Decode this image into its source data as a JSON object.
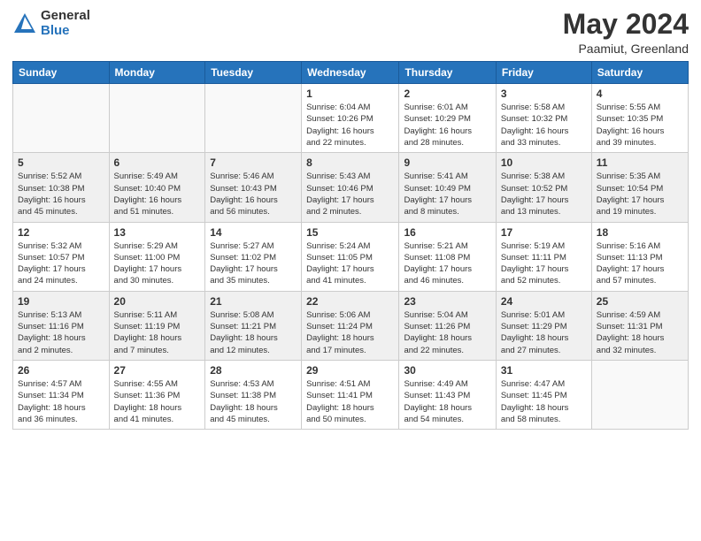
{
  "header": {
    "logo_general": "General",
    "logo_blue": "Blue",
    "month_title": "May 2024",
    "location": "Paamiut, Greenland"
  },
  "weekdays": [
    "Sunday",
    "Monday",
    "Tuesday",
    "Wednesday",
    "Thursday",
    "Friday",
    "Saturday"
  ],
  "weeks": [
    [
      {
        "day": "",
        "info": ""
      },
      {
        "day": "",
        "info": ""
      },
      {
        "day": "",
        "info": ""
      },
      {
        "day": "1",
        "info": "Sunrise: 6:04 AM\nSunset: 10:26 PM\nDaylight: 16 hours\nand 22 minutes."
      },
      {
        "day": "2",
        "info": "Sunrise: 6:01 AM\nSunset: 10:29 PM\nDaylight: 16 hours\nand 28 minutes."
      },
      {
        "day": "3",
        "info": "Sunrise: 5:58 AM\nSunset: 10:32 PM\nDaylight: 16 hours\nand 33 minutes."
      },
      {
        "day": "4",
        "info": "Sunrise: 5:55 AM\nSunset: 10:35 PM\nDaylight: 16 hours\nand 39 minutes."
      }
    ],
    [
      {
        "day": "5",
        "info": "Sunrise: 5:52 AM\nSunset: 10:38 PM\nDaylight: 16 hours\nand 45 minutes."
      },
      {
        "day": "6",
        "info": "Sunrise: 5:49 AM\nSunset: 10:40 PM\nDaylight: 16 hours\nand 51 minutes."
      },
      {
        "day": "7",
        "info": "Sunrise: 5:46 AM\nSunset: 10:43 PM\nDaylight: 16 hours\nand 56 minutes."
      },
      {
        "day": "8",
        "info": "Sunrise: 5:43 AM\nSunset: 10:46 PM\nDaylight: 17 hours\nand 2 minutes."
      },
      {
        "day": "9",
        "info": "Sunrise: 5:41 AM\nSunset: 10:49 PM\nDaylight: 17 hours\nand 8 minutes."
      },
      {
        "day": "10",
        "info": "Sunrise: 5:38 AM\nSunset: 10:52 PM\nDaylight: 17 hours\nand 13 minutes."
      },
      {
        "day": "11",
        "info": "Sunrise: 5:35 AM\nSunset: 10:54 PM\nDaylight: 17 hours\nand 19 minutes."
      }
    ],
    [
      {
        "day": "12",
        "info": "Sunrise: 5:32 AM\nSunset: 10:57 PM\nDaylight: 17 hours\nand 24 minutes."
      },
      {
        "day": "13",
        "info": "Sunrise: 5:29 AM\nSunset: 11:00 PM\nDaylight: 17 hours\nand 30 minutes."
      },
      {
        "day": "14",
        "info": "Sunrise: 5:27 AM\nSunset: 11:02 PM\nDaylight: 17 hours\nand 35 minutes."
      },
      {
        "day": "15",
        "info": "Sunrise: 5:24 AM\nSunset: 11:05 PM\nDaylight: 17 hours\nand 41 minutes."
      },
      {
        "day": "16",
        "info": "Sunrise: 5:21 AM\nSunset: 11:08 PM\nDaylight: 17 hours\nand 46 minutes."
      },
      {
        "day": "17",
        "info": "Sunrise: 5:19 AM\nSunset: 11:11 PM\nDaylight: 17 hours\nand 52 minutes."
      },
      {
        "day": "18",
        "info": "Sunrise: 5:16 AM\nSunset: 11:13 PM\nDaylight: 17 hours\nand 57 minutes."
      }
    ],
    [
      {
        "day": "19",
        "info": "Sunrise: 5:13 AM\nSunset: 11:16 PM\nDaylight: 18 hours\nand 2 minutes."
      },
      {
        "day": "20",
        "info": "Sunrise: 5:11 AM\nSunset: 11:19 PM\nDaylight: 18 hours\nand 7 minutes."
      },
      {
        "day": "21",
        "info": "Sunrise: 5:08 AM\nSunset: 11:21 PM\nDaylight: 18 hours\nand 12 minutes."
      },
      {
        "day": "22",
        "info": "Sunrise: 5:06 AM\nSunset: 11:24 PM\nDaylight: 18 hours\nand 17 minutes."
      },
      {
        "day": "23",
        "info": "Sunrise: 5:04 AM\nSunset: 11:26 PM\nDaylight: 18 hours\nand 22 minutes."
      },
      {
        "day": "24",
        "info": "Sunrise: 5:01 AM\nSunset: 11:29 PM\nDaylight: 18 hours\nand 27 minutes."
      },
      {
        "day": "25",
        "info": "Sunrise: 4:59 AM\nSunset: 11:31 PM\nDaylight: 18 hours\nand 32 minutes."
      }
    ],
    [
      {
        "day": "26",
        "info": "Sunrise: 4:57 AM\nSunset: 11:34 PM\nDaylight: 18 hours\nand 36 minutes."
      },
      {
        "day": "27",
        "info": "Sunrise: 4:55 AM\nSunset: 11:36 PM\nDaylight: 18 hours\nand 41 minutes."
      },
      {
        "day": "28",
        "info": "Sunrise: 4:53 AM\nSunset: 11:38 PM\nDaylight: 18 hours\nand 45 minutes."
      },
      {
        "day": "29",
        "info": "Sunrise: 4:51 AM\nSunset: 11:41 PM\nDaylight: 18 hours\nand 50 minutes."
      },
      {
        "day": "30",
        "info": "Sunrise: 4:49 AM\nSunset: 11:43 PM\nDaylight: 18 hours\nand 54 minutes."
      },
      {
        "day": "31",
        "info": "Sunrise: 4:47 AM\nSunset: 11:45 PM\nDaylight: 18 hours\nand 58 minutes."
      },
      {
        "day": "",
        "info": ""
      }
    ]
  ]
}
